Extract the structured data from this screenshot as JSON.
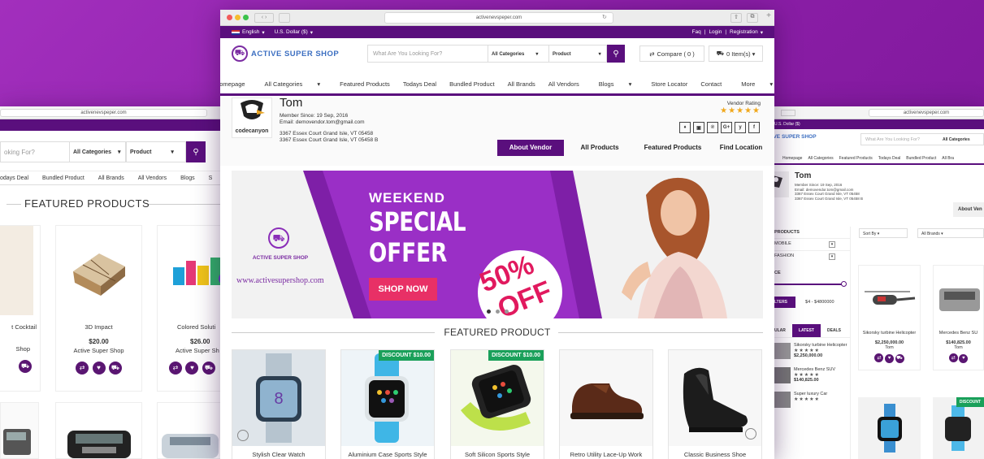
{
  "left_window": {
    "url": "activenevspeper.com",
    "search_placeholder": "oking For?",
    "category_select": "All Categories",
    "product_select": "Product",
    "nav_items": [
      "odays Deal",
      "Bundled Product",
      "All Brands",
      "All Vendors",
      "Blogs",
      "S"
    ],
    "section_title": "FEATURED PRODUCTS",
    "products": [
      {
        "name": "t Cocktail",
        "price": "",
        "vendor": "Shop"
      },
      {
        "name": "3D Impact",
        "price": "$20.00",
        "vendor": "Active Super Shop"
      },
      {
        "name": "Colored Soluti",
        "price": "$26.00",
        "vendor": "Active Super Sh"
      }
    ]
  },
  "main_window": {
    "url": "activenevspeper.com",
    "topbar": {
      "language": "English",
      "currency": "U.S. Dollar ($)",
      "links": [
        "Faq",
        "Login",
        "Registration"
      ]
    },
    "logo_text": "ACTIVE SUPER SHOP",
    "search_placeholder": "What Are You Looking For?",
    "category_select": "All Categories",
    "product_select": "Product",
    "compare_label": "Compare ( 0 )",
    "cart_label": "0 Item(s)",
    "nav_items": [
      "Homepage",
      "All Categories",
      "Featured Products",
      "Todays Deal",
      "Bundled Product",
      "All Brands",
      "All Vendors",
      "Blogs",
      "Store Locator",
      "Contact",
      "More"
    ],
    "vendor": {
      "name": "Tom",
      "logo_text": "codecanyon",
      "member_since": "Member Since: 19 Sep, 2016",
      "email": "Email: demovendor.tom@gmail.com",
      "address1": "3367 Essex Court Grand Isle, VT 05458",
      "address2": "3367 Essex Court Grand Isle, VT 05458 B",
      "rating_label": "Vendor Rating",
      "stars": "★★★★★",
      "social": [
        "♦",
        "▣",
        "℗",
        "G+",
        "y",
        "f"
      ]
    },
    "vendor_tabs": [
      "About Vendor",
      "All Products",
      "Featured Products",
      "Find Location"
    ],
    "banner": {
      "shop_name": "ACTIVE SUPER SHOP",
      "website": "www.activesupershop.com",
      "line1": "WEEKEND",
      "line2": "SPECIAL",
      "line3": "OFFER",
      "button": "SHOP NOW",
      "discount_num": "50%",
      "discount_word": "OFF"
    },
    "section_title": "FEATURED PRODUCT",
    "products": [
      {
        "name": "Stylish Clear Watch",
        "badge": ""
      },
      {
        "name": "Aluminium Case Sports Style",
        "badge": "DISCOUNT $10.00"
      },
      {
        "name": "Soft Silicon Sports Style",
        "badge": "DISCOUNT $10.00"
      },
      {
        "name": "Retro Utility Lace-Up Work",
        "badge": ""
      },
      {
        "name": "Classic Business Shoe",
        "badge": ""
      }
    ]
  },
  "right_window": {
    "url": "activenevspeper.com",
    "currency": "U.S. Dollar ($)",
    "logo_text": "CTIVE SUPER SHOP",
    "search_placeholder": "What Are You Looking For?",
    "category_select": "All Categories",
    "nav_items": [
      "Homepage",
      "All Categories",
      "Featured Products",
      "Todays Deal",
      "Bundled Product",
      "All Bra"
    ],
    "vendor_name": "Tom",
    "member_since": "Member Since: 19 Sep, 2016",
    "email": "Email: demovendor.tom@gmail.com",
    "address1": "3367 Essex Court Grand Isle, VT 05458",
    "address2": "3367 Essex Court Grand Isle, VT 05458 B",
    "about_tab": "About Ven",
    "sidebar_title": "PRODUCTS",
    "categories": [
      "MOBILE",
      "FASHION"
    ],
    "price_label": "CE",
    "filter_label": "LTERS",
    "price_range": "$4 - $4800000",
    "tabs": [
      "ULAR",
      "LATEST",
      "DEALS"
    ],
    "sort_label": "Sort By",
    "brand_label": "All Brands",
    "list_items": [
      {
        "name": "Sikorsky turbine Helicopter",
        "price": "$2,250,000.00"
      },
      {
        "name": "Mercedes Benz SUV",
        "price": "$140,825.00"
      },
      {
        "name": "Super luxury Car",
        "price": ""
      }
    ],
    "grid_products": [
      {
        "name": "Sikorsky turbine Helicopter",
        "price": "$2,250,000.00",
        "vendor": "Tom"
      },
      {
        "name": "Mercedes Benz SU",
        "price": "$140,825.00",
        "vendor": "Tom"
      }
    ],
    "badge": "DISCOUNT"
  }
}
